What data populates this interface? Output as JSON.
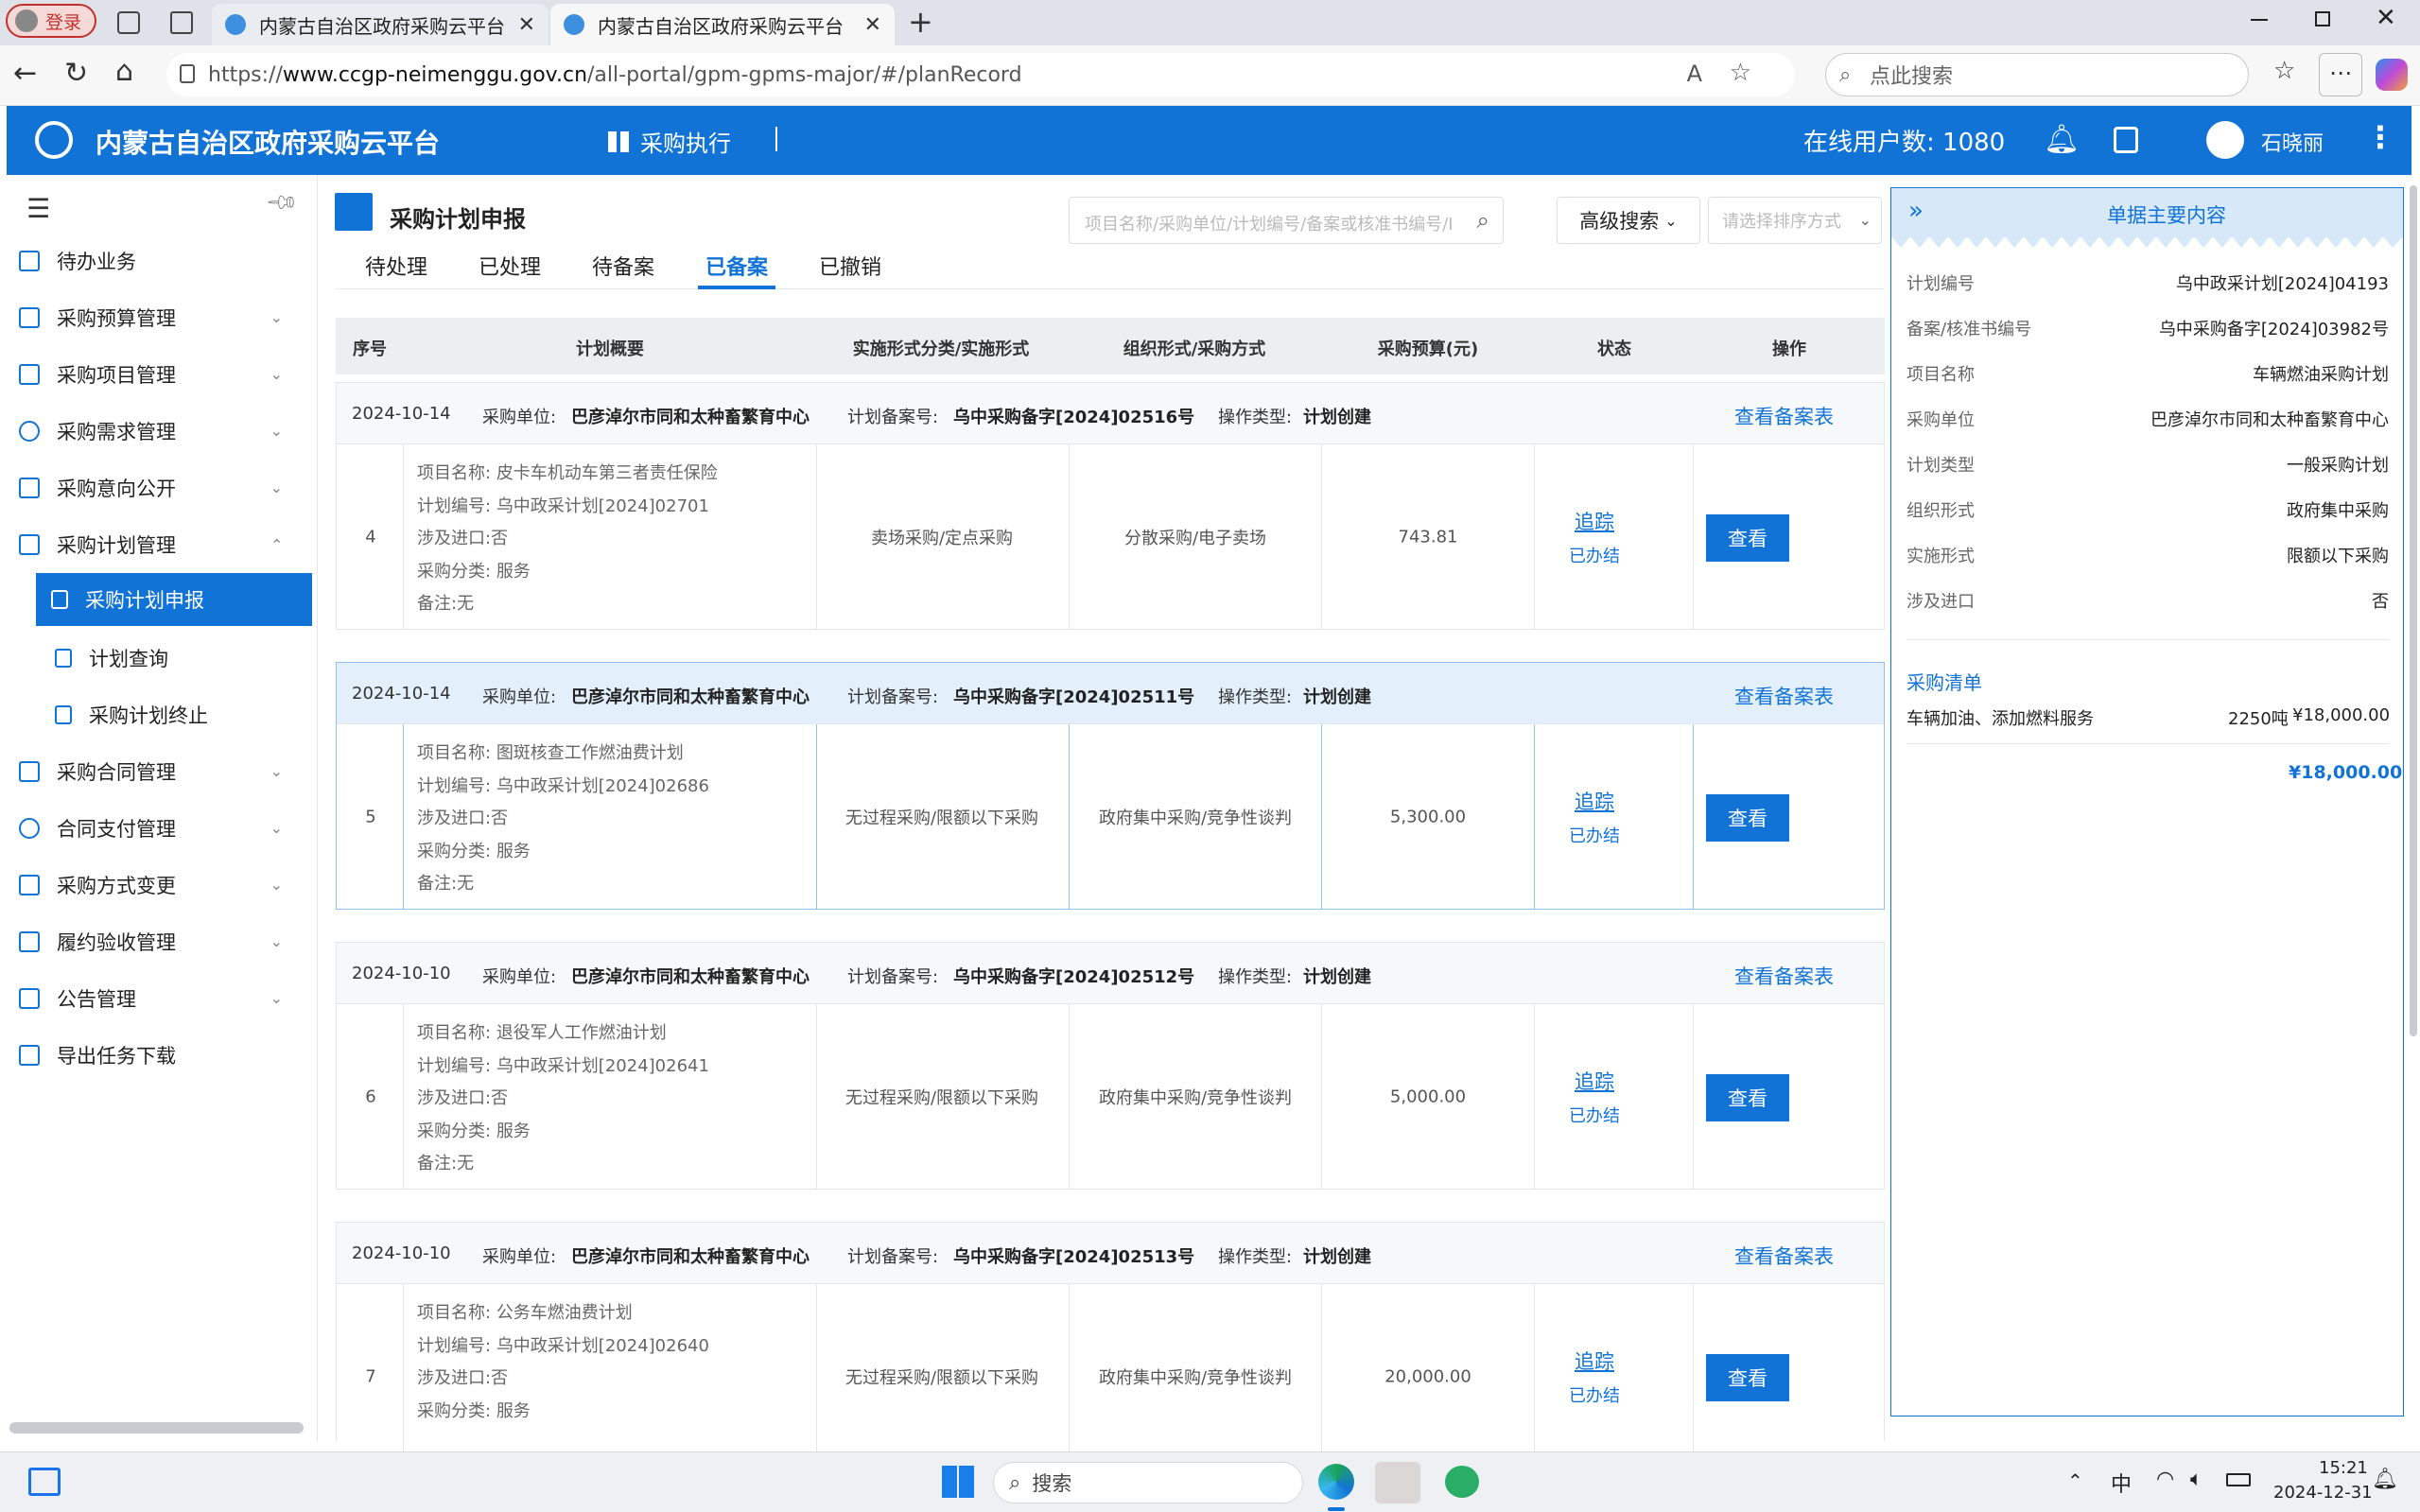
{
  "browser": {
    "login_label": "登录",
    "tabs": [
      {
        "title": "内蒙古自治区政府采购云平台",
        "active": false
      },
      {
        "title": "内蒙古自治区政府采购云平台",
        "active": true
      }
    ],
    "url_prefix": "https://",
    "url_host": "www.ccgp-neimenggu.gov.cn",
    "url_path": "/all-portal/gpm-gpms-major/#/planRecord",
    "search_placeholder": "点此搜索"
  },
  "header": {
    "title": "内蒙古自治区政府采购云平台",
    "module": "采购执行",
    "online_label": "在线用户数:",
    "online_count": "1080",
    "user": "石晓丽"
  },
  "sidebar": {
    "items": [
      {
        "label": "待办业务",
        "icon": "todo-icon"
      },
      {
        "label": "采购预算管理",
        "icon": "budget-icon"
      },
      {
        "label": "采购项目管理",
        "icon": "project-icon"
      },
      {
        "label": "采购需求管理",
        "icon": "demand-icon"
      },
      {
        "label": "采购意向公开",
        "icon": "intent-icon"
      },
      {
        "label": "采购计划管理",
        "icon": "plan-icon"
      },
      {
        "label": "采购计划申报",
        "icon": "declare-icon"
      },
      {
        "label": "计划查询",
        "icon": "query-icon"
      },
      {
        "label": "采购计划终止",
        "icon": "terminate-icon"
      },
      {
        "label": "采购合同管理",
        "icon": "contract-icon"
      },
      {
        "label": "合同支付管理",
        "icon": "payment-icon"
      },
      {
        "label": "采购方式变更",
        "icon": "change-icon"
      },
      {
        "label": "履约验收管理",
        "icon": "accept-icon"
      },
      {
        "label": "公告管理",
        "icon": "notice-icon"
      },
      {
        "label": "导出任务下载",
        "icon": "export-icon"
      }
    ]
  },
  "page": {
    "title": "采购计划申报",
    "search_placeholder": "项目名称/采购单位/计划编号/备案或核准书编号/I",
    "advanced_search": "高级搜索",
    "sort_placeholder": "请选择排序方式",
    "tabs": [
      "待处理",
      "已处理",
      "待备案",
      "已备案",
      "已撤销"
    ],
    "active_tab": "已备案"
  },
  "table": {
    "columns": [
      "序号",
      "计划概要",
      "实施形式分类/实施形式",
      "组织形式/采购方式",
      "采购预算(元)",
      "状态",
      "操作"
    ],
    "labels": {
      "unit": "采购单位:",
      "record_no": "计划备案号:",
      "op_type": "操作类型:",
      "view_record": "查看备案表",
      "project_name": "项目名称:",
      "plan_no": "计划编号:",
      "import": "涉及进口:",
      "category": "采购分类:",
      "remark": "备注:",
      "track": "追踪",
      "done": "已办结",
      "view": "查看"
    },
    "rows": [
      {
        "date": "2024-10-14",
        "unit": "巴彦淖尔市同和太种畜繁育中心",
        "record_no": "乌中采购备字[2024]02516号",
        "op_type": "计划创建",
        "seq": "4",
        "project": "皮卡车机动车第三者责任保险",
        "plan_no": "乌中政采计划[2024]02701",
        "import": "否",
        "category": "服务",
        "remark": "无",
        "impl": "卖场采购/定点采购",
        "org": "分散采购/电子卖场",
        "budget": "743.81"
      },
      {
        "date": "2024-10-14",
        "unit": "巴彦淖尔市同和太种畜繁育中心",
        "record_no": "乌中采购备字[2024]02511号",
        "op_type": "计划创建",
        "seq": "5",
        "project": "图斑核查工作燃油费计划",
        "plan_no": "乌中政采计划[2024]02686",
        "import": "否",
        "category": "服务",
        "remark": "无",
        "impl": "无过程采购/限额以下采购",
        "org": "政府集中采购/竞争性谈判",
        "budget": "5,300.00"
      },
      {
        "date": "2024-10-10",
        "unit": "巴彦淖尔市同和太种畜繁育中心",
        "record_no": "乌中采购备字[2024]02512号",
        "op_type": "计划创建",
        "seq": "6",
        "project": "退役军人工作燃油计划",
        "plan_no": "乌中政采计划[2024]02641",
        "import": "否",
        "category": "服务",
        "remark": "无",
        "impl": "无过程采购/限额以下采购",
        "org": "政府集中采购/竞争性谈判",
        "budget": "5,000.00"
      },
      {
        "date": "2024-10-10",
        "unit": "巴彦淖尔市同和太种畜繁育中心",
        "record_no": "乌中采购备字[2024]02513号",
        "op_type": "计划创建",
        "seq": "7",
        "project": "公务车燃油费计划",
        "plan_no": "乌中政采计划[2024]02640",
        "import": "否",
        "category": "服务",
        "remark": "",
        "impl": "无过程采购/限额以下采购",
        "org": "政府集中采购/竞争性谈判",
        "budget": "20,000.00"
      }
    ]
  },
  "panel": {
    "title": "单据主要内容",
    "fields": [
      {
        "k": "计划编号",
        "v": "乌中政采计划[2024]04193"
      },
      {
        "k": "备案/核准书编号",
        "v": "乌中采购备字[2024]03982号"
      },
      {
        "k": "项目名称",
        "v": "车辆燃油采购计划"
      },
      {
        "k": "采购单位",
        "v": "巴彦淖尔市同和太种畜繁育中心"
      },
      {
        "k": "计划类型",
        "v": "一般采购计划"
      },
      {
        "k": "组织形式",
        "v": "政府集中采购"
      },
      {
        "k": "实施形式",
        "v": "限额以下采购"
      },
      {
        "k": "涉及进口",
        "v": "否"
      }
    ],
    "list_title": "采购清单",
    "list_item": "车辆加油、添加燃料服务",
    "list_qty": "2250吨",
    "list_amount": "¥18,000.00",
    "total": "¥18,000.00"
  },
  "taskbar": {
    "search": "搜索",
    "ime": "中",
    "time": "15:21",
    "date": "2024-12-31"
  },
  "colors": {
    "primary": "#1273d6",
    "header": "#1273d6",
    "selected_row": "#e3f0fc"
  }
}
